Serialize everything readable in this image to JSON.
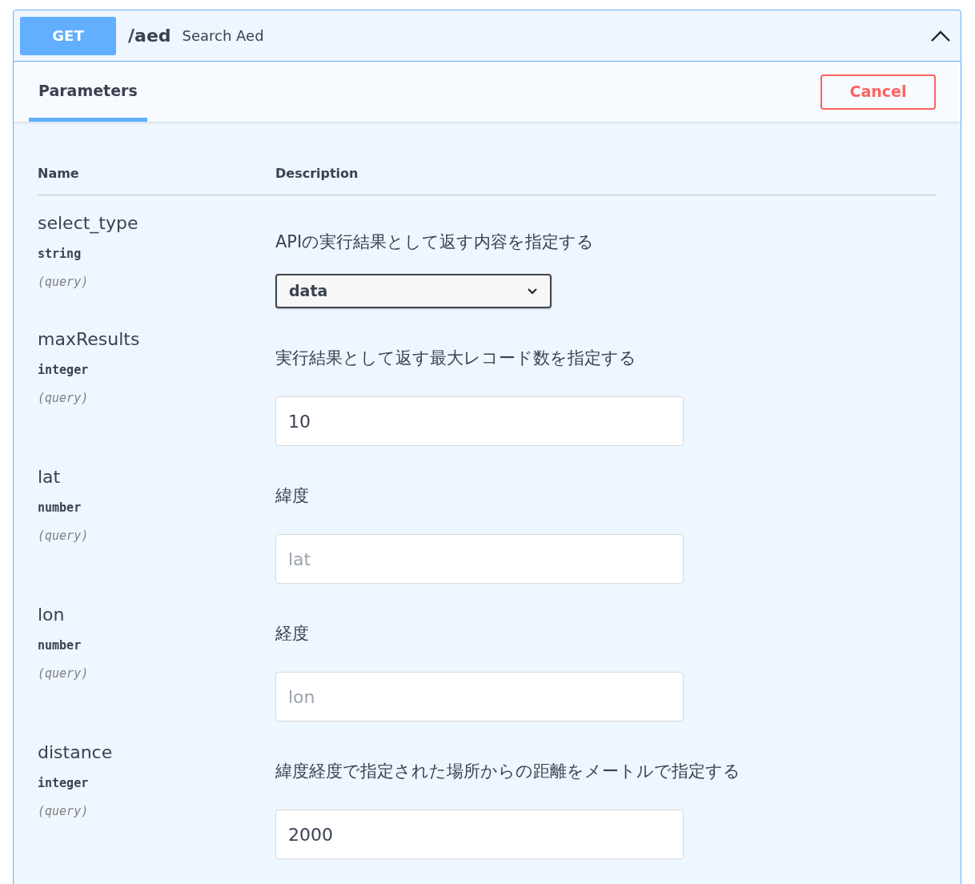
{
  "operation": {
    "method": "GET",
    "path": "/aed",
    "summary": "Search Aed",
    "expanded": true
  },
  "tabs": [
    {
      "label": "Parameters",
      "selected": true
    }
  ],
  "cancel_button": "Cancel",
  "table": {
    "columns": [
      "Name",
      "Description"
    ],
    "rows": [
      {
        "name": "select_type",
        "type": "string",
        "location": "(query)",
        "description": "APIの実行結果として返す内容を指定する",
        "field": {
          "kind": "select",
          "value": "data"
        }
      },
      {
        "name": "maxResults",
        "type": "integer",
        "location": "(query)",
        "description": "実行結果として返す最大レコード数を指定する",
        "field": {
          "kind": "input",
          "value": "10"
        }
      },
      {
        "name": "lat",
        "type": "number",
        "location": "(query)",
        "description": "緯度",
        "field": {
          "kind": "input",
          "placeholder": "lat"
        }
      },
      {
        "name": "lon",
        "type": "number",
        "location": "(query)",
        "description": "経度",
        "field": {
          "kind": "input",
          "placeholder": "lon"
        }
      },
      {
        "name": "distance",
        "type": "integer",
        "location": "(query)",
        "description": "緯度経度で指定された場所からの距離をメートルで指定する",
        "field": {
          "kind": "input",
          "value": "2000"
        }
      }
    ]
  }
}
